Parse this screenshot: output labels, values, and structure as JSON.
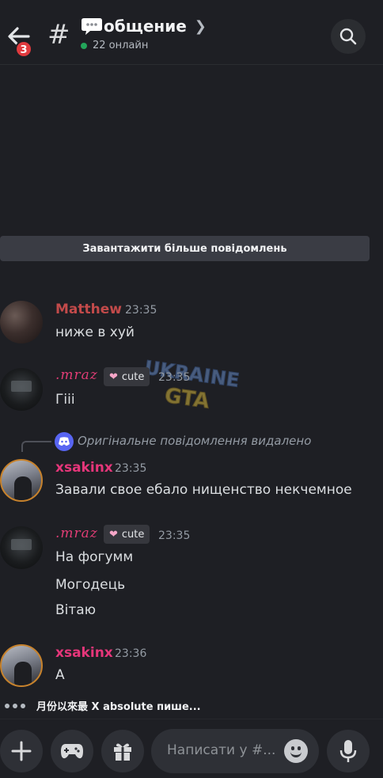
{
  "header": {
    "back_badge": "3",
    "channel_name": "общение",
    "online_status": "22 онлайн",
    "colors": {
      "online": "#23a55a",
      "badge": "#e03a3e"
    }
  },
  "load_more_label": "Завантажити більше повідомлень",
  "messages": [
    {
      "author": "Matthew",
      "time": "23:35",
      "lines": [
        "ниже в хуй"
      ]
    },
    {
      "author": ".mraz",
      "role": "cute",
      "time": "23:35",
      "lines": [
        "Гііі"
      ]
    },
    {
      "author": "xsakinx",
      "time": "23:35",
      "reply": "Оригінальне повідомлення видалено",
      "lines": [
        "Завали свое ебало нищенство некчемное"
      ]
    },
    {
      "author": ".mraz",
      "role": "cute",
      "time": "23:35",
      "lines": [
        "На фогумм",
        "Могодець",
        "Вітаю"
      ]
    },
    {
      "author": "xsakinx",
      "time": "23:36",
      "lines": [
        "А"
      ]
    }
  ],
  "watermark": {
    "top": "UKRAINE",
    "bottom": "GTA"
  },
  "typing_indicator": "月份以來最 X absolute пише...",
  "composer": {
    "placeholder": "Написати у #...",
    "icons": [
      "plus-icon",
      "gamepad-icon",
      "gift-icon",
      "emoji-icon",
      "microphone-icon"
    ]
  }
}
